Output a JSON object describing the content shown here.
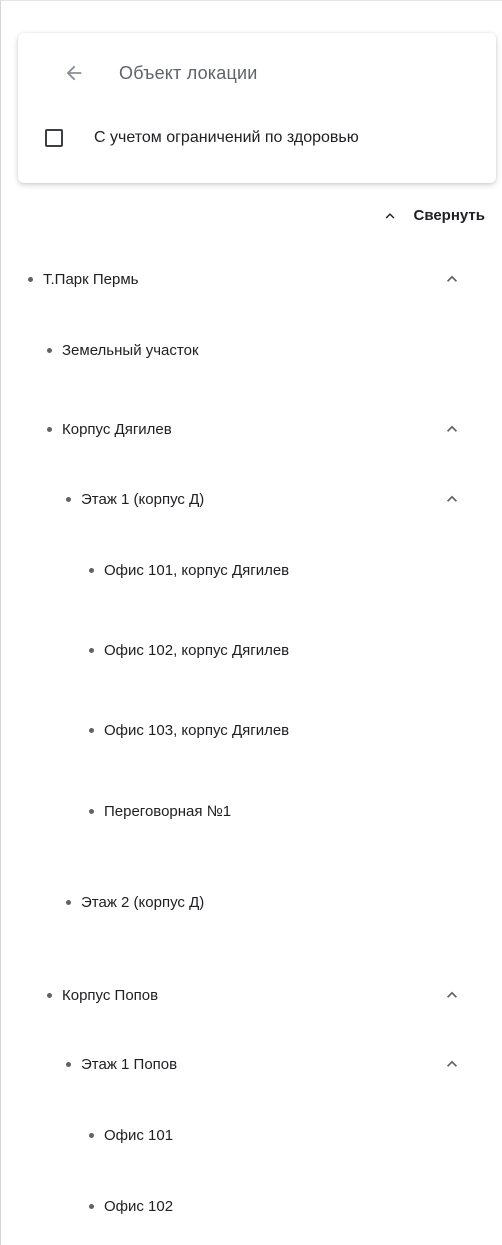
{
  "header": {
    "title": "Объект локации",
    "back_icon": "arrow-left-icon",
    "health_checkbox_label": "С учетом ограничений по здоровью",
    "health_checkbox_checked": false
  },
  "controls": {
    "collapse_label": "Свернуть",
    "collapse_icon": "chevron-up-icon"
  },
  "tree": [
    {
      "label": "Т.Парк Пермь",
      "level": 0,
      "expanded": true,
      "has_children": true
    },
    {
      "label": "Земельный участок",
      "level": 1,
      "expanded": false,
      "has_children": false
    },
    {
      "label": "Корпус Дягилев",
      "level": 1,
      "expanded": true,
      "has_children": true
    },
    {
      "label": "Этаж 1 (корпус Д)",
      "level": 2,
      "expanded": true,
      "has_children": true
    },
    {
      "label": "Офис 101, корпус Дягилев",
      "level": 3,
      "expanded": false,
      "has_children": false
    },
    {
      "label": "Офис 102, корпус Дягилев",
      "level": 3,
      "expanded": false,
      "has_children": false
    },
    {
      "label": "Офис 103, корпус Дягилев",
      "level": 3,
      "expanded": false,
      "has_children": false
    },
    {
      "label": "Переговорная №1",
      "level": 3,
      "expanded": false,
      "has_children": false
    },
    {
      "label": "Этаж 2 (корпус Д)",
      "level": 2,
      "expanded": false,
      "has_children": false
    },
    {
      "label": "Корпус Попов",
      "level": 1,
      "expanded": true,
      "has_children": true
    },
    {
      "label": "Этаж 1 Попов",
      "level": 2,
      "expanded": true,
      "has_children": true
    },
    {
      "label": "Офис 101",
      "level": 3,
      "expanded": false,
      "has_children": false
    },
    {
      "label": "Офис 102",
      "level": 3,
      "expanded": false,
      "has_children": false
    }
  ]
}
